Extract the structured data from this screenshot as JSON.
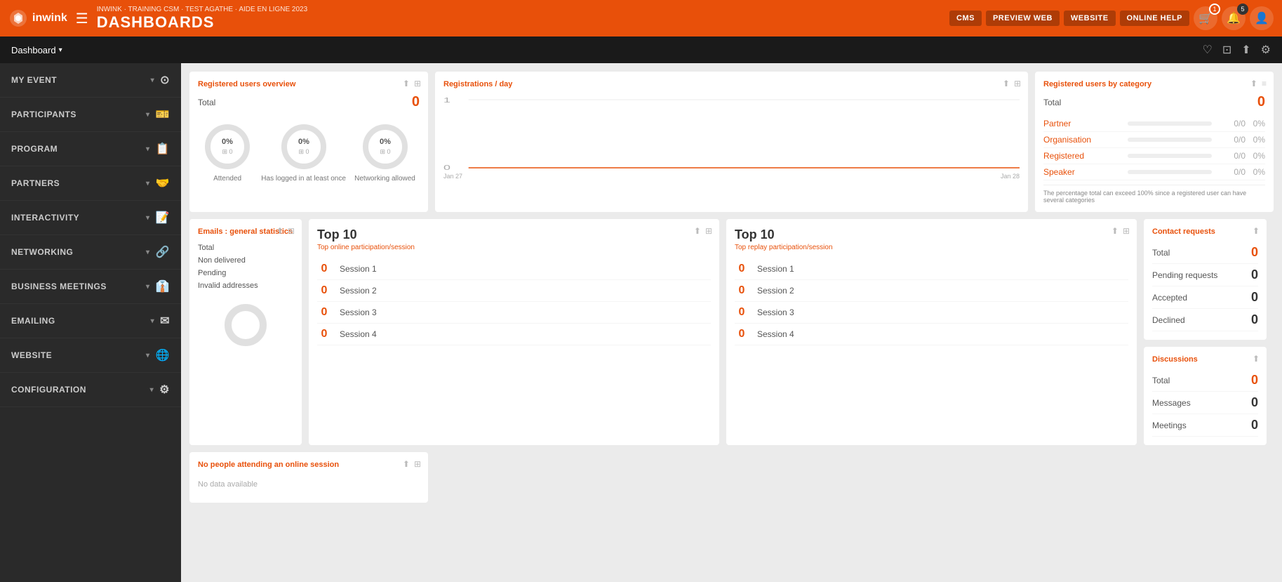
{
  "logo": {
    "text": "inwink",
    "icon": "●"
  },
  "header": {
    "breadcrumb": "INWINK · TRAINING CSM · TEST AGATHE · AIDE EN LIGNE 2023",
    "title": "DASHBOARDS",
    "buttons": [
      {
        "label": "CMS",
        "id": "cms"
      },
      {
        "label": "PREVIEW WEB",
        "id": "preview-web"
      },
      {
        "label": "WEBSITE",
        "id": "website"
      },
      {
        "label": "ONLINE HELP",
        "id": "online-help"
      }
    ],
    "cart_badge": "1",
    "notif_badge": "5"
  },
  "subheader": {
    "tab_label": "Dashboard",
    "icons": [
      "♡",
      "⊡",
      "⬆",
      "⚙"
    ]
  },
  "sidebar": {
    "items": [
      {
        "label": "MY EVENT",
        "icon": "⊙",
        "id": "my-event"
      },
      {
        "label": "PARTICIPANTS",
        "icon": "🎫",
        "id": "participants"
      },
      {
        "label": "PROGRAM",
        "icon": "📋",
        "id": "program"
      },
      {
        "label": "PARTNERS",
        "icon": "🤝",
        "id": "partners"
      },
      {
        "label": "INTERACTIVITY",
        "icon": "📝",
        "id": "interactivity"
      },
      {
        "label": "NETWORKING",
        "icon": "🔗",
        "id": "networking"
      },
      {
        "label": "BUSINESS MEETINGS",
        "icon": "👔",
        "id": "business-meetings"
      },
      {
        "label": "EMAILING",
        "icon": "✉",
        "id": "emailing"
      },
      {
        "label": "WEBSITE",
        "icon": "🌐",
        "id": "website"
      },
      {
        "label": "CONFIGURATION",
        "icon": "⚙",
        "id": "configuration"
      }
    ]
  },
  "dashboard": {
    "overview": {
      "title": "Registered users overview",
      "total_label": "Total",
      "total_value": "0",
      "circles": [
        {
          "label": "Attended",
          "pct": "0%",
          "count": "0"
        },
        {
          "label": "Has logged in at least once",
          "pct": "0%",
          "count": "0"
        },
        {
          "label": "Networking allowed",
          "pct": "0%",
          "count": "0"
        }
      ]
    },
    "registrations_day": {
      "title": "Registrations / day",
      "y_label": "1",
      "y_zero": "0",
      "date_start": "Jan 27",
      "date_end": "Jan 28"
    },
    "by_category": {
      "title": "Registered users by category",
      "total_label": "Total",
      "total_value": "0",
      "categories": [
        {
          "name": "Partner",
          "fraction": "0/0",
          "pct": "0%"
        },
        {
          "name": "Organisation",
          "fraction": "0/0",
          "pct": "0%"
        },
        {
          "name": "Registered",
          "fraction": "0/0",
          "pct": "0%"
        },
        {
          "name": "Speaker",
          "fraction": "0/0",
          "pct": "0%"
        }
      ],
      "note": "The percentage total can exceed 100% since a registered user can have several categories"
    },
    "emails": {
      "title": "Emails : general statistics",
      "rows": [
        {
          "label": "Total",
          "value": ""
        },
        {
          "label": "Non delivered",
          "value": ""
        },
        {
          "label": "Pending",
          "value": ""
        },
        {
          "label": "Invalid addresses",
          "value": ""
        }
      ]
    },
    "top10_online": {
      "title": "Top 10",
      "subtitle": "Top online participation/session",
      "sessions": [
        {
          "num": "0",
          "label": "Session 1"
        },
        {
          "num": "0",
          "label": "Session 2"
        },
        {
          "num": "0",
          "label": "Session 3"
        },
        {
          "num": "0",
          "label": "Session 4"
        }
      ]
    },
    "top10_replay": {
      "title": "Top 10",
      "subtitle": "Top replay participation/session",
      "sessions": [
        {
          "num": "0",
          "label": "Session 1"
        },
        {
          "num": "0",
          "label": "Session 2"
        },
        {
          "num": "0",
          "label": "Session 3"
        },
        {
          "num": "0",
          "label": "Session 4"
        }
      ]
    },
    "contact_requests": {
      "title": "Contact requests",
      "total_label": "Total",
      "total_value": "0",
      "rows": [
        {
          "label": "Pending requests",
          "value": "0"
        },
        {
          "label": "Accepted",
          "value": "0"
        },
        {
          "label": "Declined",
          "value": "0"
        }
      ]
    },
    "discussions": {
      "title": "Discussions",
      "total_label": "Total",
      "total_value": "0",
      "rows": [
        {
          "label": "Messages",
          "value": "0"
        },
        {
          "label": "Meetings",
          "value": "0"
        }
      ]
    },
    "no_people": {
      "title": "No people attending an online session",
      "no_data": "No data available"
    }
  }
}
